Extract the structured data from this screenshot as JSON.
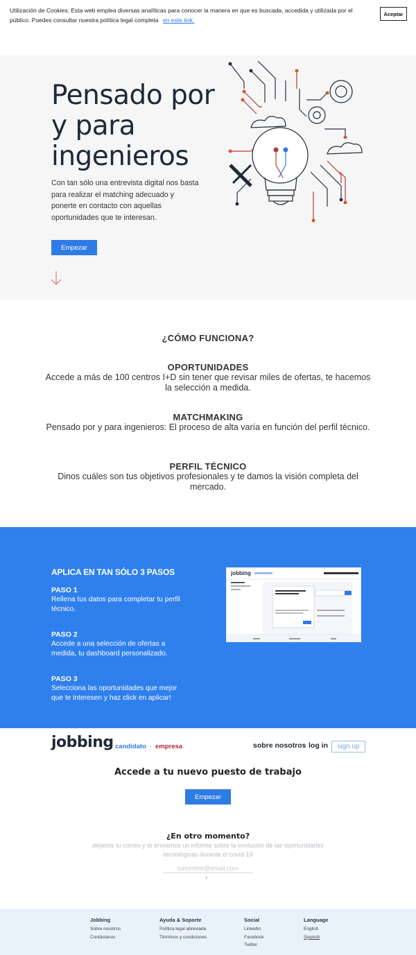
{
  "cookie": {
    "text": "Utilización de Cookies: Esta web emplea diversas analíticas para conocer la manera en que es buscada, accedida y utilizada por el público. Puedes consultar nuestra política legal completa",
    "link": "en este link.",
    "accept": "Aceptar"
  },
  "hero": {
    "title": "Pensado por y para ingenieros",
    "description": "Con tan sólo una entrevista digital nos basta para realizar el matching adecuado y ponerte en contacto con aquellas oportunidades que te interesan.",
    "button": "Empezar"
  },
  "how": {
    "title": "¿CÓMO FUNCIONA?",
    "features": [
      {
        "title": "OPORTUNIDADES",
        "text": "Accede a más de 100 centros I+D sin tener que revisar miles de ofertas, te hacemos la selección a medida."
      },
      {
        "title": "MATCHMAKING",
        "text": "Pensado por y para ingenieros: El proceso de alta varía en función del perfil técnico."
      },
      {
        "title": "PERFIL TÉCNICO",
        "text": "Dinos cuáles son tus objetivos profesionales y te damos la visión completa del mercado."
      }
    ]
  },
  "steps": {
    "title": "APLICA EN TAN SÓLO 3 PASOS",
    "items": [
      {
        "label": "PASO 1",
        "text": "Rellena tus datos para completar tu perfil técnico."
      },
      {
        "label": "PASO 2",
        "text": "Accede a una selección de ofertas a medida, tu dashboard personalizado."
      },
      {
        "label": "PASO 3",
        "text": "Selecciona las oportunidades que mejor que te interesen y haz click en aplicar!"
      }
    ],
    "screenshot_logo": "jobbing"
  },
  "header": {
    "logo": "jobbing",
    "candidato": "candidato",
    "sep": "·",
    "empresa": "empresa",
    "about": "sobre nosotros",
    "login": "log in",
    "signup": "sign up"
  },
  "cta": {
    "title": "Accede a tu nuevo puesto de trabajo",
    "button": "Empezar"
  },
  "later": {
    "title": "¿En otro momento?",
    "text": "déjanos tu correo y te enviamos un informe sobre la evolución de las oportunidades tecnológicas durante el covid-19",
    "placeholder": "tunombre@email.com",
    "send": "›"
  },
  "footer": {
    "columns": [
      {
        "title": "Jobbing",
        "items": [
          "Sobre nosotros",
          "Contáctanos"
        ]
      },
      {
        "title": "Ayuda & Soporte",
        "items": [
          "Política legal abreviada",
          "Términos y condiciones"
        ]
      },
      {
        "title": "Social",
        "items": [
          "Linkedin",
          "Facebook",
          "Twitter"
        ]
      },
      {
        "title": "Language",
        "items": [
          "English",
          "Spanish"
        ]
      }
    ]
  },
  "colors": {
    "primary": "#2f7be5",
    "steps_bg": "#2f80ed",
    "dark": "#1e2a38",
    "accent_red": "#b5243b",
    "footer_bg": "#e9f1fb"
  }
}
